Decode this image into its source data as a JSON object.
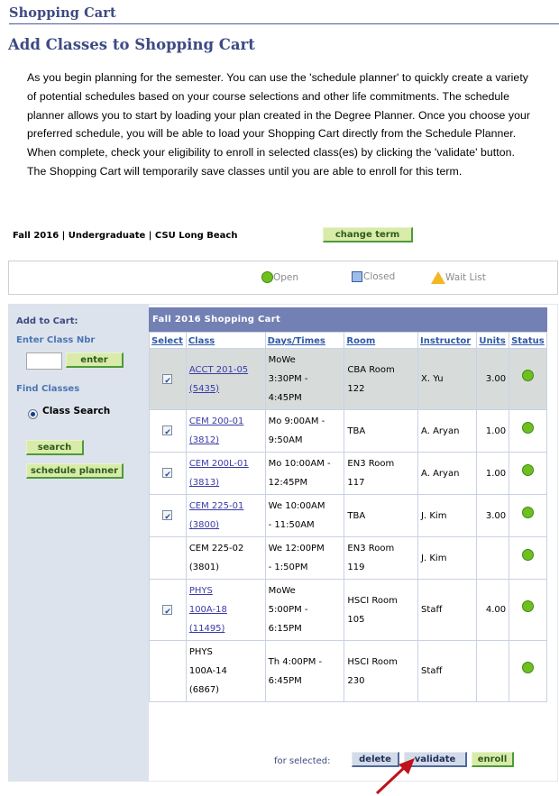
{
  "header": {
    "section_title": "Shopping Cart",
    "page_title": "Add Classes to Shopping Cart"
  },
  "intro_text": "As you begin planning for the semester.  You can use the 'schedule planner' to quickly create a variety of potential schedules based on your course selections and other life commitments. The schedule planner allows you to start by loading your plan created in the Degree Planner. Once you choose your preferred schedule, you will be able to load your Shopping Cart directly from the Schedule Planner. When complete, check your eligibility to enroll in selected class(es) by clicking the 'validate' button. The Shopping Cart will temporarily save classes until you are able to enroll for this term.",
  "term": {
    "label": "Fall 2016 | Undergraduate | CSU Long Beach",
    "change_term_label": "change term"
  },
  "legend": {
    "open": "Open",
    "closed": "Closed",
    "wait_list": "Wait List",
    "colors": {
      "open": "#6fbf20",
      "closed": "#9dbde8",
      "wait_list": "#f2b723"
    }
  },
  "add_to_cart": {
    "title": "Add to Cart:",
    "enter_class_nbr_label": "Enter Class Nbr",
    "class_nbr_value": "",
    "enter_button": "enter",
    "find_classes_label": "Find Classes",
    "class_search_option": "Class Search",
    "class_search_selected": true,
    "search_button": "search",
    "schedule_planner_button": "schedule planner"
  },
  "cart": {
    "title": "Fall 2016 Shopping Cart",
    "columns": [
      "Select",
      "Class",
      "Days/Times",
      "Room",
      "Instructor",
      "Units",
      "Status"
    ],
    "rows": [
      {
        "selectable": true,
        "checked": true,
        "highlighted": true,
        "class_lines": [
          "ACCT 201-05",
          "(5435)"
        ],
        "is_link": true,
        "days_times": [
          "MoWe",
          "3:30PM -",
          "4:45PM"
        ],
        "room": [
          "CBA  Room",
          "122"
        ],
        "instructor": "X. Yu",
        "units": "3.00",
        "status": "Open"
      },
      {
        "selectable": true,
        "checked": true,
        "highlighted": false,
        "class_lines": [
          "CEM 200-01",
          "(3812)"
        ],
        "is_link": true,
        "days_times": [
          "Mo 9:00AM -",
          "9:50AM"
        ],
        "room": [
          "TBA"
        ],
        "instructor": "A. Aryan",
        "units": "1.00",
        "status": "Open"
      },
      {
        "selectable": true,
        "checked": true,
        "highlighted": false,
        "class_lines": [
          "CEM 200L-01",
          "(3813)"
        ],
        "is_link": true,
        "days_times": [
          "Mo 10:00AM -",
          "12:45PM"
        ],
        "room": [
          "EN3  Room",
          "117"
        ],
        "instructor": "A. Aryan",
        "units": "1.00",
        "status": "Open"
      },
      {
        "selectable": true,
        "checked": true,
        "highlighted": false,
        "class_lines": [
          "CEM 225-01",
          "(3800)"
        ],
        "is_link": true,
        "days_times": [
          "We 10:00AM",
          "- 11:50AM"
        ],
        "room": [
          "TBA"
        ],
        "instructor": "J. Kim",
        "units": "3.00",
        "status": "Open"
      },
      {
        "selectable": false,
        "checked": false,
        "highlighted": false,
        "class_lines": [
          "CEM 225-02",
          "(3801)"
        ],
        "is_link": false,
        "days_times": [
          "We 12:00PM",
          "- 1:50PM"
        ],
        "room": [
          "EN3  Room",
          "119"
        ],
        "instructor": "J. Kim",
        "units": "",
        "status": "Open"
      },
      {
        "selectable": true,
        "checked": true,
        "highlighted": false,
        "class_lines": [
          "PHYS",
          "100A-18",
          "(11495)"
        ],
        "is_link": true,
        "days_times": [
          "MoWe",
          "5:00PM -",
          "6:15PM"
        ],
        "room": [
          "HSCI Room",
          "105"
        ],
        "instructor": "Staff",
        "units": "4.00",
        "status": "Open"
      },
      {
        "selectable": false,
        "checked": false,
        "highlighted": false,
        "class_lines": [
          "PHYS",
          "100A-14",
          "(6867)"
        ],
        "is_link": false,
        "days_times": [
          "Th 4:00PM -",
          "6:45PM"
        ],
        "room": [
          "HSCI Room",
          "230"
        ],
        "instructor": "Staff",
        "units": "",
        "status": "Open"
      }
    ],
    "for_selected_label": "for selected:",
    "delete_button": "delete",
    "validate_button": "validate",
    "enroll_button": "enroll"
  },
  "annotation": {
    "arrow_color": "#c0121a",
    "arrow_target": "validate"
  }
}
